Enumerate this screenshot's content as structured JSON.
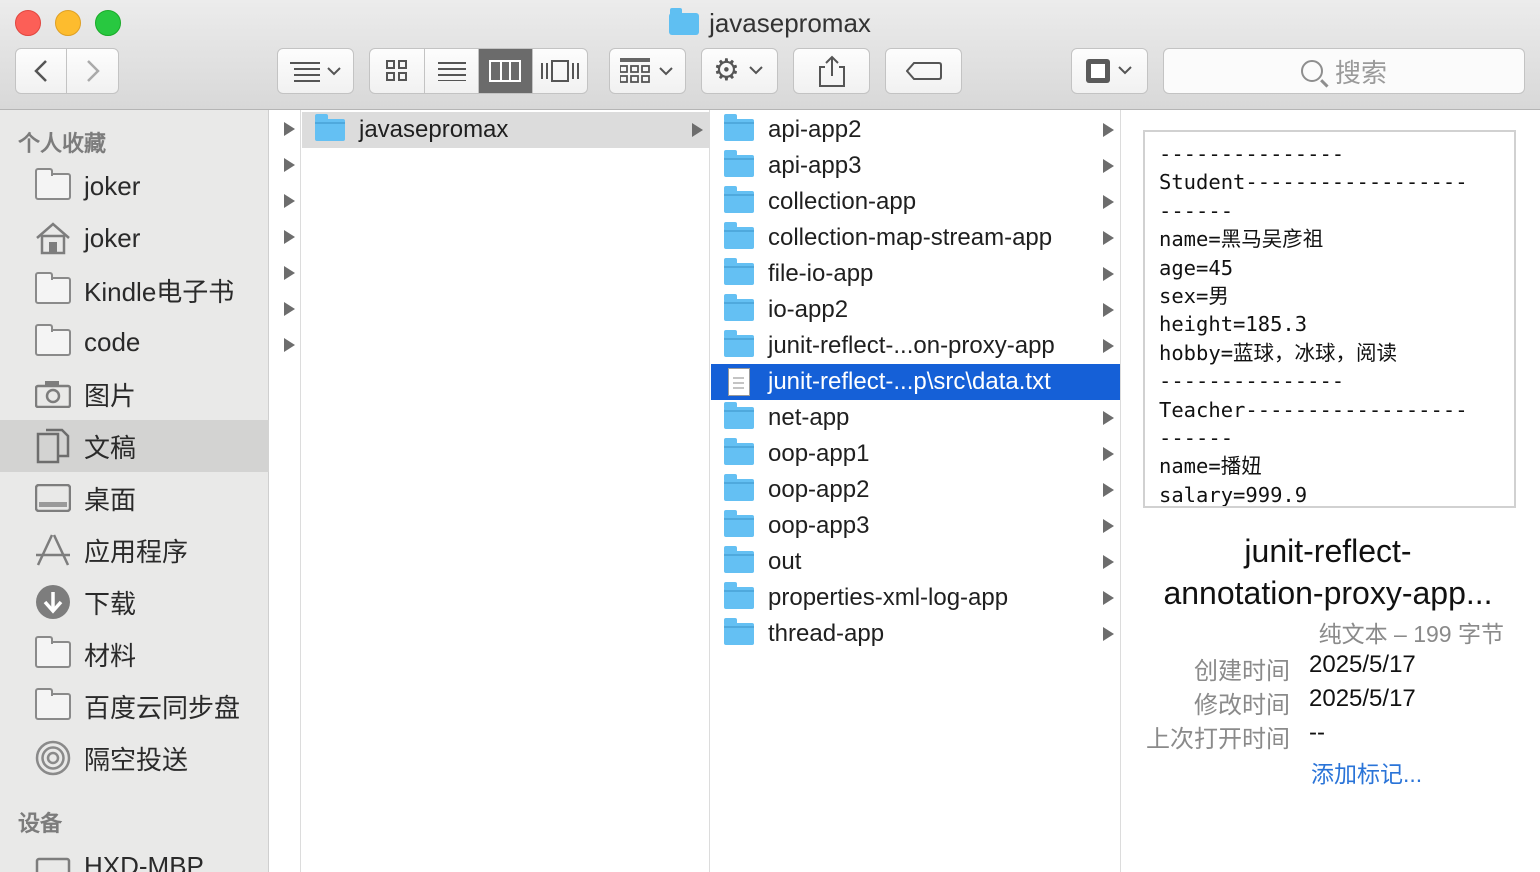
{
  "window": {
    "title": "javasepromax"
  },
  "toolbar": {
    "search_placeholder": "搜索",
    "back_icon": "chevron-left-icon",
    "forward_icon": "chevron-right-icon"
  },
  "sidebar": {
    "favorites_heading": "个人收藏",
    "devices_heading": "设备",
    "items": [
      {
        "label": "joker",
        "icon": "folder-icon"
      },
      {
        "label": "joker",
        "icon": "home-icon"
      },
      {
        "label": "Kindle电子书",
        "icon": "folder-icon"
      },
      {
        "label": "code",
        "icon": "folder-icon"
      },
      {
        "label": "图片",
        "icon": "camera-icon"
      },
      {
        "label": "文稿",
        "icon": "documents-icon",
        "selected": true
      },
      {
        "label": "桌面",
        "icon": "desktop-icon"
      },
      {
        "label": "应用程序",
        "icon": "applications-icon"
      },
      {
        "label": "下载",
        "icon": "download-icon"
      },
      {
        "label": "材料",
        "icon": "folder-icon"
      },
      {
        "label": "百度云同步盘",
        "icon": "folder-icon"
      },
      {
        "label": "隔空投送",
        "icon": "airdrop-icon"
      }
    ],
    "devices": [
      {
        "label": "HXD-MBP",
        "icon": "computer-icon"
      }
    ]
  },
  "column2": {
    "items": [
      {
        "label": "javasepromax"
      }
    ]
  },
  "column3": {
    "items": [
      {
        "label": "api-app2",
        "type": "folder"
      },
      {
        "label": "api-app3",
        "type": "folder"
      },
      {
        "label": "collection-app",
        "type": "folder"
      },
      {
        "label": "collection-map-stream-app",
        "type": "folder"
      },
      {
        "label": "file-io-app",
        "type": "folder"
      },
      {
        "label": "io-app2",
        "type": "folder"
      },
      {
        "label": "junit-reflect-...on-proxy-app",
        "type": "folder"
      },
      {
        "label": "junit-reflect-...p\\src\\data.txt",
        "type": "file",
        "selected": true
      },
      {
        "label": "net-app",
        "type": "folder"
      },
      {
        "label": "oop-app1",
        "type": "folder"
      },
      {
        "label": "oop-app2",
        "type": "folder"
      },
      {
        "label": "oop-app3",
        "type": "folder"
      },
      {
        "label": "out",
        "type": "folder"
      },
      {
        "label": "properties-xml-log-app",
        "type": "folder"
      },
      {
        "label": "thread-app",
        "type": "folder"
      }
    ]
  },
  "preview": {
    "text_lines": [
      "---------------",
      "Student------------------",
      "------",
      "name=黑马吴彦祖",
      "age=45",
      "sex=男",
      "height=185.3",
      "hobby=蓝球，冰球，阅读",
      "---------------",
      "Teacher------------------",
      "------",
      "name=播妞",
      "salary=999.9"
    ],
    "name_line1": "junit-reflect-",
    "name_line2": "annotation-proxy-app...",
    "kind": "纯文本 – 199 字节",
    "created_label": "创建时间",
    "created_value": "2025/5/17",
    "modified_label": "修改时间",
    "modified_value": "2025/5/17",
    "opened_label": "上次打开时间",
    "opened_value": "--",
    "add_tags": "添加标记..."
  },
  "colors": {
    "selection_blue": "#1560d7",
    "folder_blue": "#64c0f3",
    "link_blue": "#2a74d8"
  }
}
